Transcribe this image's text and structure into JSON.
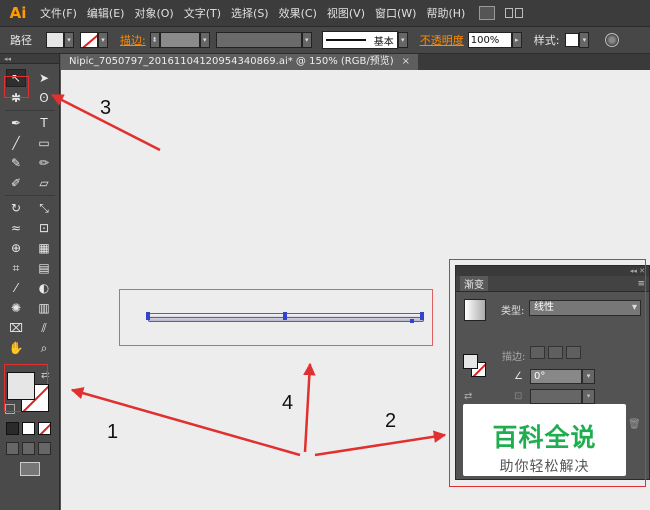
{
  "app": {
    "logo": "Ai"
  },
  "menu": [
    "文件(F)",
    "编辑(E)",
    "对象(O)",
    "文字(T)",
    "选择(S)",
    "效果(C)",
    "视图(V)",
    "窗口(W)",
    "帮助(H)"
  ],
  "control_bar": {
    "object_type": "路径",
    "stroke_label": "描边:",
    "stroke_profile": "基本",
    "opacity_label": "不透明度",
    "opacity_value": "100%",
    "style_label": "样式:"
  },
  "document_tab": {
    "title": "Nipic_7050797_20161104120954340869.ai* @ 150% (RGB/预览)",
    "close": "×"
  },
  "gradient_panel": {
    "title": "渐变",
    "type_label": "类型:",
    "type_value": "线性",
    "stroke_label": "描边:",
    "angle_value": "0°"
  },
  "watermark": {
    "main": "百科全说",
    "sub": "助你轻松解决"
  },
  "annotations": [
    "1",
    "2",
    "3",
    "4"
  ],
  "colors": {
    "annotation_red": "#e03030",
    "ai_orange": "#ff9a00",
    "watermark_green": "#1fae4f"
  }
}
